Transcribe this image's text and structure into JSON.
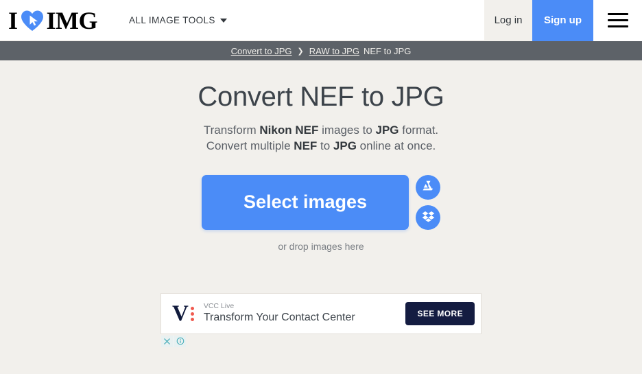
{
  "header": {
    "logo": {
      "left_text": "I",
      "heart_icon": "heart-cursor-icon",
      "right_text": "IMG"
    },
    "all_tools_label": "ALL IMAGE TOOLS",
    "caret_icon": "chevron-down-icon",
    "login_label": "Log in",
    "signup_label": "Sign up",
    "menu_icon": "hamburger-menu-icon",
    "colors": {
      "accent_blue": "#4b8cf7",
      "beige": "#f2f0ec",
      "header_bg": "#ffffff"
    }
  },
  "breadcrumb": {
    "items": [
      {
        "label": "Convert to JPG",
        "link": true
      },
      {
        "label": "RAW to JPG",
        "link": true
      },
      {
        "label": "NEF to JPG",
        "link": false
      }
    ],
    "separator": "❯",
    "bar_color": "#5d6268"
  },
  "main": {
    "title": "Convert NEF to JPG",
    "subtitle_line1": {
      "part1": "Transform ",
      "strong1": "Nikon NEF",
      "part2": " images to ",
      "strong2": "JPG",
      "part3": " format."
    },
    "subtitle_line2": {
      "part1": "Convert multiple ",
      "strong1": "NEF",
      "part2": " to ",
      "strong2": "JPG",
      "part3": " online at once."
    },
    "select_button_label": "Select images",
    "google_drive_icon": "google-drive-icon",
    "dropbox_icon": "dropbox-icon",
    "drop_hint": "or drop images here"
  },
  "ad": {
    "logo_letter": "V",
    "logo_icon": "vcc-live-logo-icon",
    "brand": "VCC Live",
    "headline": "Transform Your Contact Center",
    "cta_label": "SEE MORE",
    "close_icon": "close-icon",
    "info_icon": "info-icon",
    "cta_color": "#141c41",
    "dot_color": "#f05a4f"
  }
}
